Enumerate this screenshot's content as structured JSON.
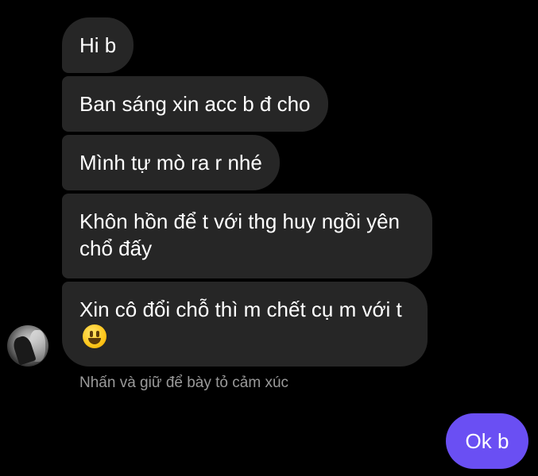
{
  "conversation": {
    "incoming_messages": [
      "Hi b",
      "Ban sáng xin acc b đ cho",
      "Mình tự mò ra r nhé",
      "Khôn hồn để t với thg huy ngồi yên chổ đấy",
      "Xin cô đổi chỗ thì m chết cụ m với t"
    ],
    "emoji_icon": "grinning-face-emoji",
    "reaction_hint": "Nhấn và giữ để bày tỏ cảm xúc",
    "outgoing_messages": [
      "Ok b"
    ]
  },
  "colors": {
    "background": "#000000",
    "incoming_bubble": "#262626",
    "outgoing_bubble": "#6a4ff3",
    "hint_text": "#9a9a9a"
  }
}
